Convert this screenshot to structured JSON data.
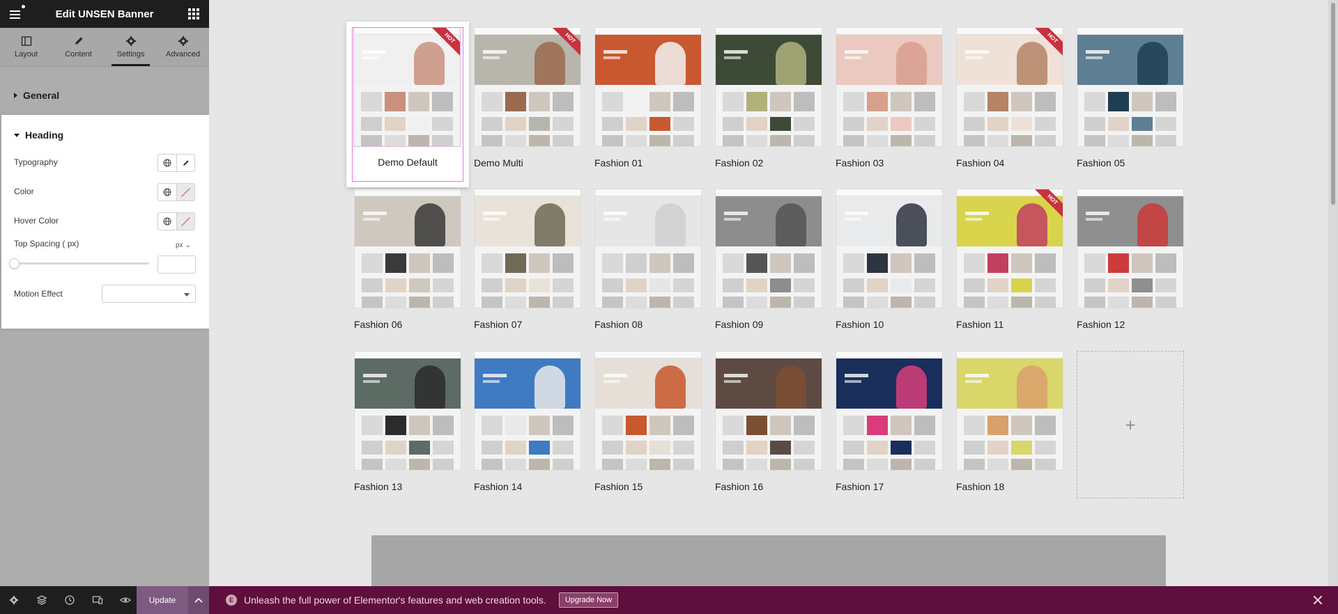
{
  "panel": {
    "title": "Edit UNSEN Banner",
    "tabs": [
      {
        "label": "Layout",
        "icon": "layout-icon"
      },
      {
        "label": "Content",
        "icon": "pencil-icon"
      },
      {
        "label": "Settings",
        "icon": "gear-icon",
        "active": true
      },
      {
        "label": "Advanced",
        "icon": "gear-icon"
      }
    ],
    "sections": {
      "general": "General",
      "heading": "Heading"
    },
    "controls": {
      "typography": "Typography",
      "color": "Color",
      "hover_color": "Hover Color",
      "top_spacing": "Top Spacing ( px)",
      "top_spacing_unit": "px",
      "top_spacing_value": "",
      "motion_effect": "Motion Effect",
      "motion_effect_value": ""
    },
    "footer": {
      "update_label": "Update"
    }
  },
  "canvas": {
    "demos": [
      {
        "label": "Demo Default",
        "hot": true,
        "selected": true,
        "color": "#f0f0f0",
        "fig": "#c9907e"
      },
      {
        "label": "Demo Multi",
        "hot": true,
        "color": "#b8b6ac",
        "fig": "#9a6a4e"
      },
      {
        "label": "Fashion 01",
        "hot": false,
        "color": "#c9572f",
        "fig": "#f2f2f2"
      },
      {
        "label": "Fashion 02",
        "hot": false,
        "color": "#3d4a36",
        "fig": "#b0b27c"
      },
      {
        "label": "Fashion 03",
        "hot": false,
        "color": "#ebc9c0",
        "fig": "#d79f8c"
      },
      {
        "label": "Fashion 04",
        "hot": true,
        "color": "#efe1d8",
        "fig": "#b58466"
      },
      {
        "label": "Fashion 05",
        "hot": false,
        "color": "#5e7f93",
        "fig": "#1f3e52"
      },
      {
        "label": "Fashion 06",
        "hot": false,
        "color": "#cfc8bf",
        "fig": "#3a3a3a"
      },
      {
        "label": "Fashion 07",
        "hot": false,
        "color": "#e9e2d9",
        "fig": "#6f6a56"
      },
      {
        "label": "Fashion 08",
        "hot": false,
        "color": "#e6e6e6",
        "fig": "#cfcfcf"
      },
      {
        "label": "Fashion 09",
        "hot": false,
        "color": "#8d8d8d",
        "fig": "#555555"
      },
      {
        "label": "Fashion 10",
        "hot": false,
        "color": "#e8eaec",
        "fig": "#2e3440"
      },
      {
        "label": "Fashion 11",
        "hot": true,
        "color": "#d8d44b",
        "fig": "#c23f62"
      },
      {
        "label": "Fashion 12",
        "hot": false,
        "color": "#8f8f8f",
        "fig": "#cc3a3a"
      },
      {
        "label": "Fashion 13",
        "hot": false,
        "color": "#5c6b63",
        "fig": "#2c2c2c"
      },
      {
        "label": "Fashion 14",
        "hot": false,
        "color": "#3e7bc3",
        "fig": "#e9e9e9"
      },
      {
        "label": "Fashion 15",
        "hot": false,
        "color": "#e5dfd8",
        "fig": "#c8582d"
      },
      {
        "label": "Fashion 16",
        "hot": false,
        "color": "#5d4a42",
        "fig": "#7b4f33"
      },
      {
        "label": "Fashion 17",
        "hot": false,
        "color": "#1a2e5c",
        "fig": "#d73d7a"
      },
      {
        "label": "Fashion 18",
        "hot": false,
        "color": "#d9d66a",
        "fig": "#d8a06a"
      }
    ],
    "hot_badge": "HOT",
    "add_label": "+"
  },
  "promo": {
    "text": "Unleash the full power of Elementor's features and web creation tools.",
    "cta": "Upgrade Now"
  },
  "colors": {
    "accent": "#5e0f3b",
    "update_button": "#7d5a80",
    "selection_outline": "#e07ad8"
  }
}
